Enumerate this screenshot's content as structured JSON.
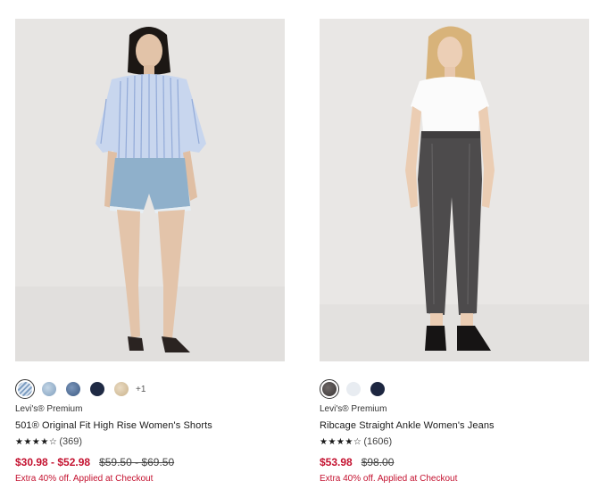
{
  "products": [
    {
      "image_alt": "model wearing light blue striped shirt and denim shorts",
      "swatches": [
        {
          "name": "light-stripe-blue",
          "color": "#b9cde0",
          "selected": true
        },
        {
          "name": "light-wash-blue",
          "color": "#8fadc8",
          "selected": false
        },
        {
          "name": "medium-wash-blue",
          "color": "#4b6a92",
          "selected": false
        },
        {
          "name": "dark-navy",
          "color": "#1f2a44",
          "selected": false
        },
        {
          "name": "tan",
          "color": "#d6c2a2",
          "selected": false
        }
      ],
      "more_swatches": "+1",
      "brand": "Levi's® Premium",
      "name": "501® Original Fit High Rise Women's Shorts",
      "rating": 4,
      "stars": "★★★★☆",
      "reviews": "(369)",
      "price": "$30.98 - $52.98",
      "original_price": "$59.50 - $69.50",
      "promo": "Extra 40% off. Applied at Checkout"
    },
    {
      "image_alt": "model wearing white t-shirt and grey straight ankle jeans",
      "swatches": [
        {
          "name": "charcoal-grey",
          "color": "#4a4645",
          "selected": true
        },
        {
          "name": "white",
          "color": "#e8ecf1",
          "selected": false
        },
        {
          "name": "dark-navy",
          "color": "#1d2640",
          "selected": false
        }
      ],
      "more_swatches": "",
      "brand": "Levi's® Premium",
      "name": "Ribcage Straight Ankle Women's Jeans",
      "rating": 4,
      "stars": "★★★★☆",
      "reviews": "(1606)",
      "price": "$53.98",
      "original_price": "$98.00",
      "promo": "Extra 40% off. Applied at Checkout"
    }
  ]
}
